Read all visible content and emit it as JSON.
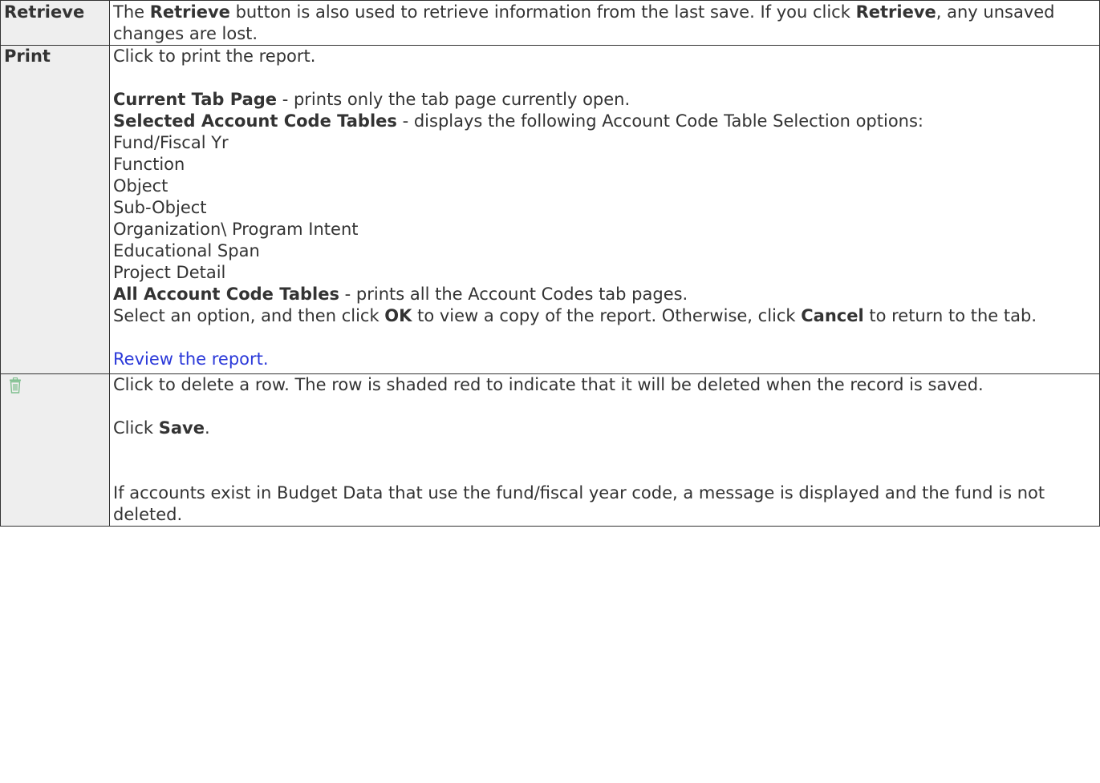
{
  "rows": {
    "retrieve": {
      "label": "Retrieve",
      "t1": "The ",
      "b1": "Retrieve",
      "t2": " button is also used to retrieve information from the last save. If you click ",
      "b2": "Retrieve",
      "t3": ", any unsaved changes are lost."
    },
    "print": {
      "label": "Print",
      "intro": "Click to print the report.",
      "opt_current_label": "Current Tab Page",
      "opt_current_text": " - prints only the tab page currently open.",
      "opt_selected_label": "Selected Account Code Tables",
      "opt_selected_text": " - displays the following Account Code Table Selection options:",
      "tables": [
        "Fund/Fiscal Yr",
        "Function",
        "Object",
        "Sub-Object",
        "Organization\\ Program Intent",
        "Educational Span",
        "Project Detail"
      ],
      "opt_all_label": "All Account Code Tables",
      "opt_all_text": " - prints all the Account Codes tab pages.",
      "select_t1": "Select an option, and then click ",
      "select_ok": "OK",
      "select_t2": " to view a copy of the report. Otherwise, click ",
      "select_cancel": "Cancel",
      "select_t3": " to return to the tab.",
      "review_link": "Review the report."
    },
    "delete": {
      "icon": "trash-icon",
      "icon_color": "#7fbf8e",
      "text1": "Click to delete a row. The row is shaded red to indicate that it will be deleted when the record is saved.",
      "save_t1": "Click ",
      "save_b": "Save",
      "save_t2": ".",
      "text3": "If accounts exist in Budget Data that use the fund/fiscal year code, a message is displayed and the fund is not deleted."
    }
  },
  "colors": {
    "label_bg": "#eeeeee",
    "border": "#333333",
    "text": "#333333",
    "link": "#2b39d9"
  }
}
